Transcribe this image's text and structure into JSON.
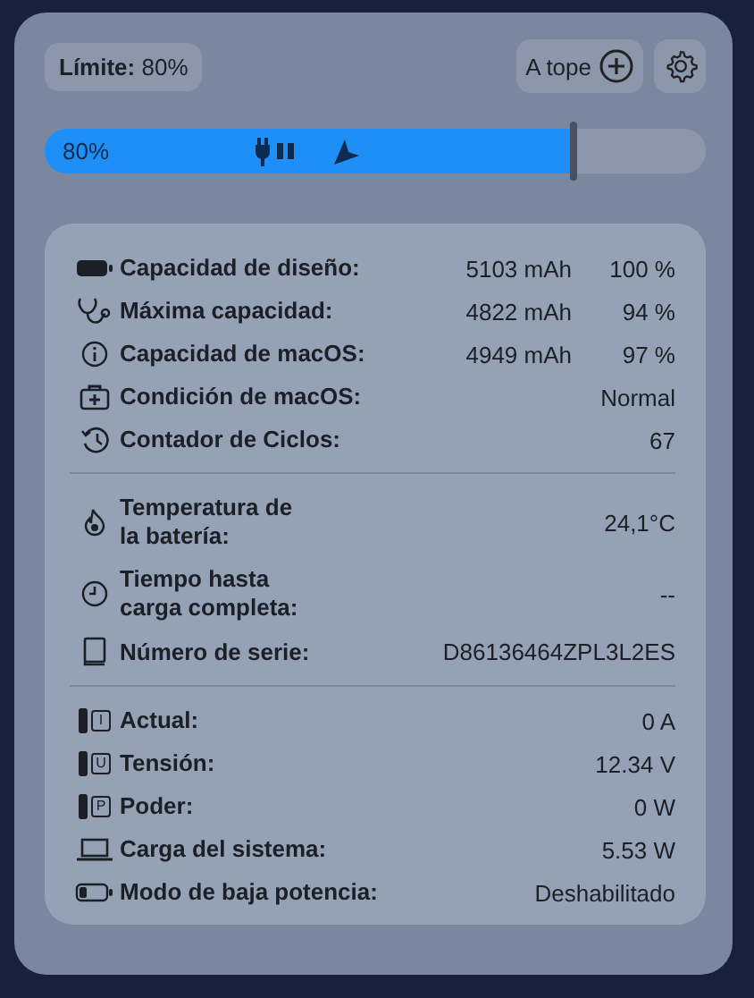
{
  "limit_chip": {
    "label": "Límite:",
    "value": "80%"
  },
  "top_button": {
    "label": "A tope"
  },
  "charge_bar": {
    "label": "80%",
    "level": 0.8
  },
  "sections": [
    [
      {
        "kind": "battery",
        "label": [
          "Capacidad de diseño:"
        ],
        "value": "5103 mAh",
        "percent": "100 %"
      },
      {
        "kind": "stethoscope",
        "label": [
          "Máxima capacidad:"
        ],
        "value": "4822 mAh",
        "percent": "94 %"
      },
      {
        "kind": "info",
        "label": [
          "Capacidad de macOS:"
        ],
        "value": "4949 mAh",
        "percent": "97 %"
      },
      {
        "kind": "medkit",
        "label": [
          "Condición de macOS:"
        ],
        "value": "Normal"
      },
      {
        "kind": "history",
        "label": [
          "Contador de Ciclos:"
        ],
        "value": "67"
      }
    ],
    [
      {
        "kind": "flame",
        "label": [
          "Temperatura de",
          "la batería:"
        ],
        "value": "24,1°C"
      },
      {
        "kind": "clock",
        "label": [
          "Tiempo hasta",
          "carga completa:"
        ],
        "value": "--"
      },
      {
        "kind": "book",
        "label": [
          "Número de serie:"
        ],
        "value": "D86136464ZPL3L2ES"
      }
    ],
    [
      {
        "kind": "battery-letter",
        "icon_letter": "I",
        "label": [
          "Actual:"
        ],
        "value": "0 A"
      },
      {
        "kind": "battery-letter",
        "icon_letter": "U",
        "label": [
          "Tensión:"
        ],
        "value": "12.34 V"
      },
      {
        "kind": "battery-letter",
        "icon_letter": "P",
        "label": [
          "Poder:"
        ],
        "value": "0 W"
      },
      {
        "kind": "laptop",
        "label": [
          "Carga del sistema:"
        ],
        "value": "5.53 W"
      },
      {
        "kind": "battery-low",
        "label": [
          "Modo de baja potencia:"
        ],
        "value": "Deshabilitado"
      }
    ]
  ]
}
